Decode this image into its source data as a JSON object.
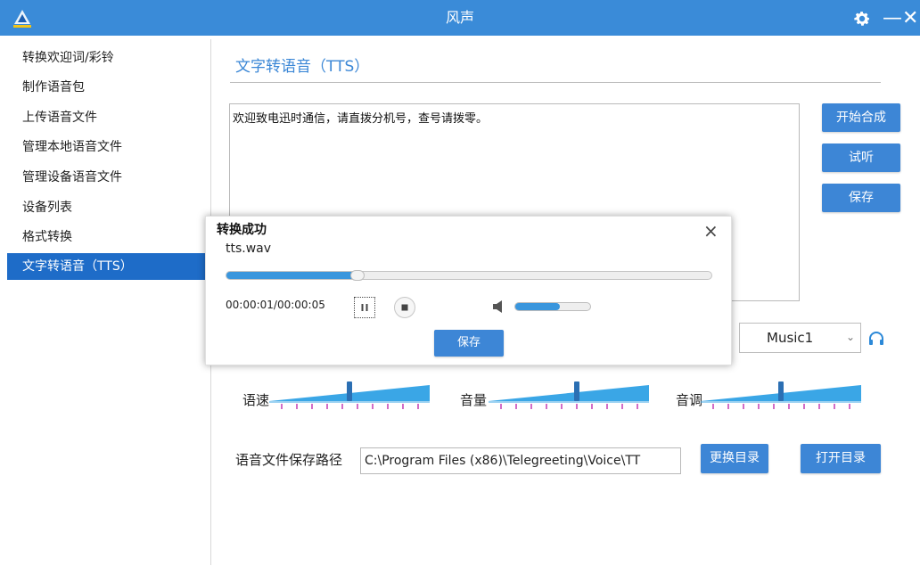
{
  "window": {
    "title": "风声",
    "accent": "#3a8bd8"
  },
  "sidebar": {
    "items": [
      {
        "label": "转换欢迎词/彩铃"
      },
      {
        "label": "制作语音包"
      },
      {
        "label": "上传语音文件"
      },
      {
        "label": "管理本地语音文件"
      },
      {
        "label": "管理设备语音文件"
      },
      {
        "label": "设备列表"
      },
      {
        "label": "格式转换"
      },
      {
        "label": "文字转语音（TTS）",
        "active": true
      }
    ]
  },
  "main": {
    "title": "文字转语音（TTS）",
    "text": "欢迎致电迅时通信，请直拨分机号，查号请拨零。",
    "buttons": {
      "synthesize": "开始合成",
      "preview": "试听",
      "save": "保存"
    },
    "music": {
      "label_fragment": "：",
      "value": "Music1"
    },
    "sliders": [
      {
        "label": "语速",
        "value": 0.5
      },
      {
        "label": "音量",
        "value": 0.55
      },
      {
        "label": "音调",
        "value": 0.5
      }
    ],
    "path": {
      "label": "语音文件保存路径",
      "value": "C:\\Program Files (x86)\\Telegreeting\\Voice\\TT",
      "change_button": "更换目录",
      "open_button": "打开目录"
    }
  },
  "dialog": {
    "title": "转换成功",
    "close_icon": "×",
    "filename": "tts.wav",
    "progress": 0.27,
    "time": "00:00:01/00:00:05",
    "volume": 0.6,
    "save": "保存"
  }
}
